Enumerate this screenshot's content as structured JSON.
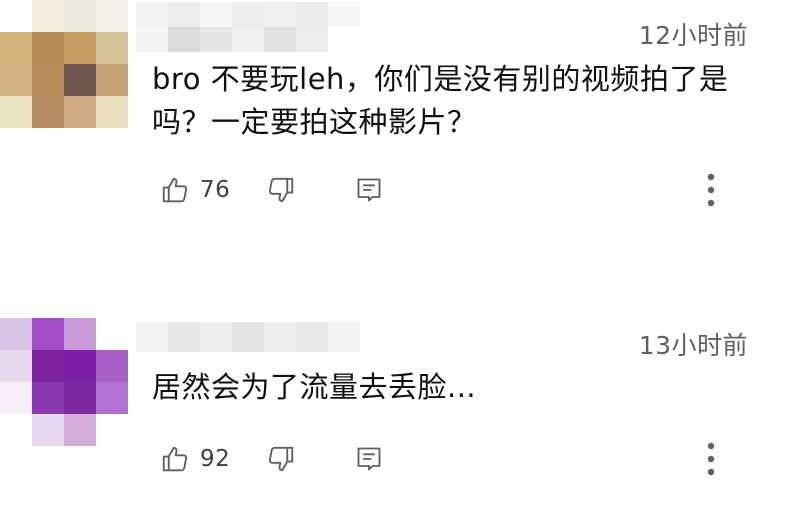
{
  "comments": [
    {
      "timestamp": "12小时前",
      "text": "bro 不要玩leh，你们是没有别的视频拍了是吗？一定要拍这种影片？",
      "likes": "76",
      "avatar_colors": [
        [
          "#ffffff",
          "#f3efe3",
          "#eceadf",
          "#f2f0ea"
        ],
        [
          "#cfb37b",
          "#b68a55",
          "#c49b62",
          "#d5c49a"
        ],
        [
          "#d0b07e",
          "#b98d5d",
          "#6e5751",
          "#c39f74"
        ],
        [
          "#ebe4c4",
          "#b78e63",
          "#d0ad85",
          "#eadfc0"
        ]
      ]
    },
    {
      "timestamp": "13小时前",
      "text": "居然会为了流量去丢脸...",
      "likes": "92",
      "avatar_colors": [
        [
          "#d9c4e6",
          "#a24cc9",
          "#c79ad9",
          "#ffffff"
        ],
        [
          "#e7d8ee",
          "#7e229f",
          "#7d1fa5",
          "#a660c6"
        ],
        [
          "#f6eff8",
          "#8a3ab0",
          "#7c2aa1",
          "#b272d2"
        ],
        [
          "#ffffff",
          "#e9d9f0",
          "#d3acd9",
          "#ffffff"
        ]
      ]
    }
  ],
  "icons": {
    "like": "thumb-up-icon",
    "dislike": "thumb-down-icon",
    "reply": "reply-icon",
    "more": "more-vertical-icon"
  },
  "colors": {
    "icon": "#606060",
    "timestamp": "#606060",
    "text": "#111111"
  }
}
